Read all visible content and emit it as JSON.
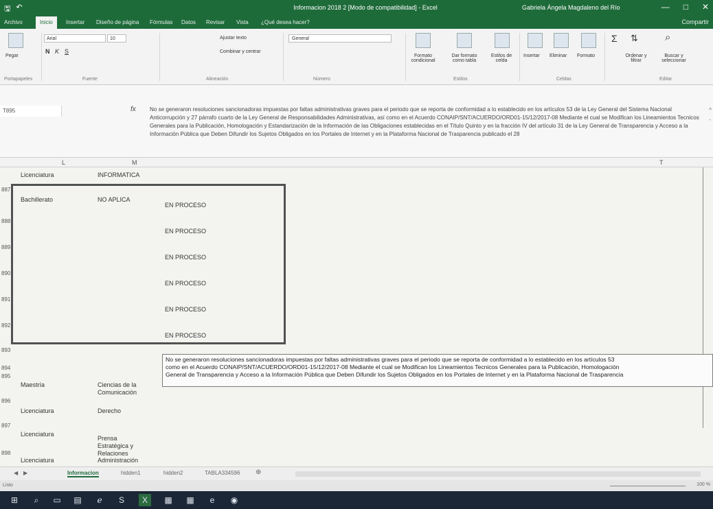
{
  "titlebar": {
    "title": "Informacion 2018 2  [Modo de compatibilidad]  -  Excel",
    "user": "Gabriela Ángela Magdaleno del Río",
    "qat_save": "🖫",
    "qat_undo": "↶",
    "min": "—",
    "max": "□",
    "close": "✕"
  },
  "tabs": {
    "archivo": "Archivo",
    "inicio": "Inicio",
    "insertar": "Insertar",
    "diseno": "Diseño de página",
    "formulas": "Fórmulas",
    "datos": "Datos",
    "revisar": "Revisar",
    "vista": "Vista",
    "help": "¿Qué desea hacer?",
    "share": "Compartir"
  },
  "ribbon": {
    "paste": "Pegar",
    "font": "Arial",
    "size": "10",
    "bold": "N",
    "italic": "K",
    "underline": "S",
    "wrap": "Ajustar texto",
    "merge": "Combinar y centrar",
    "numfmt": "General",
    "cond": "Formato condicional",
    "table": "Dar formato como tabla",
    "styles": "Estilos de celda",
    "insert": "Insertar",
    "delete": "Eliminar",
    "format": "Formato",
    "sort": "Ordenar y filtrar",
    "find": "Buscar y seleccionar",
    "g_clipboard": "Portapapeles",
    "g_font": "Fuente",
    "g_align": "Alineación",
    "g_number": "Número",
    "g_styles": "Estilos",
    "g_cells": "Celdas",
    "g_edit": "Editar"
  },
  "formula": {
    "namebox": "T895",
    "fx": "fx",
    "text": "No se generaron resoluciones sancionadoras impuestas por faltas administrativas graves para el periodo que se reporta de conformidad a lo establecido en los artículos 53 de la Ley General del Sistema Nacional Anticorrupción y 27 párrafo cuarto de la Ley General de Responsabilidades Administrativas, así como en el Acuerdo CONAIP/SNT/ACUERDO/ORD01-15/12/2017-08  Mediante el cual se Modifican los Lineamientos Tecnicos Generales para la Publicación, Homologación y Estandarización de la Información de las Obligaciones establecidas en el Título Quinto y en la fracción IV del artículo 31 de la Ley General de Transparencia y Acceso a la Información Pública que Deben Difundir los Sujetos Obligados en los Portales de Internet y en la Plataforma Nacional de Trasparencia publicado el 28"
  },
  "sheet": {
    "col_l": "L",
    "col_m": "M",
    "col_t": "T",
    "rows": [
      {
        "num": "",
        "l": "Licenciatura",
        "m": "INFORMATICA"
      },
      {
        "num": "887",
        "l": "Bachillerato",
        "m": "NO APLICA"
      },
      {
        "num": "888"
      },
      {
        "num": "889"
      },
      {
        "num": "890"
      },
      {
        "num": "891"
      },
      {
        "num": "892"
      },
      {
        "num": "893"
      },
      {
        "num": "894"
      },
      {
        "num": "895",
        "l": "Maestría",
        "m": "Ciencias de la Comunicación"
      },
      {
        "num": "896",
        "l": "Licenciatura",
        "m": "Derecho"
      },
      {
        "num": "897",
        "l": "Licenciatura",
        "m": "Prensa Estratégica y Relaciones"
      },
      {
        "num": "898",
        "l": "Licenciatura",
        "m": "Administración"
      }
    ],
    "en_proceso": [
      "EN PROCESO",
      "EN PROCESO",
      "EN PROCESO",
      "EN PROCESO",
      "EN PROCESO",
      "EN PROCESO"
    ],
    "long_lines": [
      "No se generaron resoluciones sancionadoras impuestas por faltas administrativas graves para el periodo que se reporta de conformidad a lo establecido en los artículos 53",
      "como en el Acuerdo CONAIP/SNT/ACUERDO/ORD01-15/12/2017-08  Mediante el cual se Modifican los Lineamientos Tecnicos Generales para la Publicación, Homologación",
      "General de Transparencia y Acceso a la Información Pública que Deben Difundir los Sujetos Obligados en los Portales de Internet y en la Plataforma Nacional de Trasparencia"
    ]
  },
  "sheettabs": {
    "t1": "Informacion",
    "t2": "hidden1",
    "t3": "hidden2",
    "t4": "TABLA334596",
    "add": "⊕"
  },
  "status": {
    "left": "Listo",
    "zoom": "100 %"
  }
}
